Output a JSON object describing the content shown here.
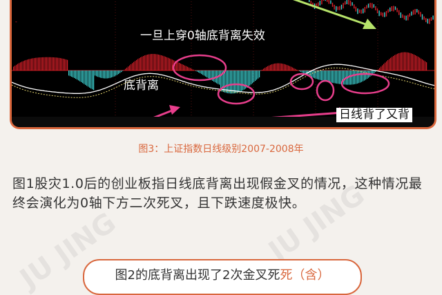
{
  "chart": {
    "annotations": {
      "zero_axis_break": "一旦上穿0轴底背离失效",
      "bottom_divergence": "底背离",
      "daily_divergence": "日线背了又背"
    }
  },
  "caption": "图3：上证指数日线级别2007-2008年",
  "paragraph": "图1股灾1.0后的创业板指日线底背离出现假金叉的情况，这种情况最终会演化为0轴下方二次死叉，且下跌速度极快。",
  "footer_pill": {
    "text": "图2的底背离出现了2次金叉死",
    "highlight": "死（含）"
  },
  "colors": {
    "accent": "#d9673d",
    "highlight_circle": "#e83e8c",
    "arrow": "#b6e36a",
    "macd_red": "#e0212b",
    "macd_cyan": "#3fd6d6"
  }
}
